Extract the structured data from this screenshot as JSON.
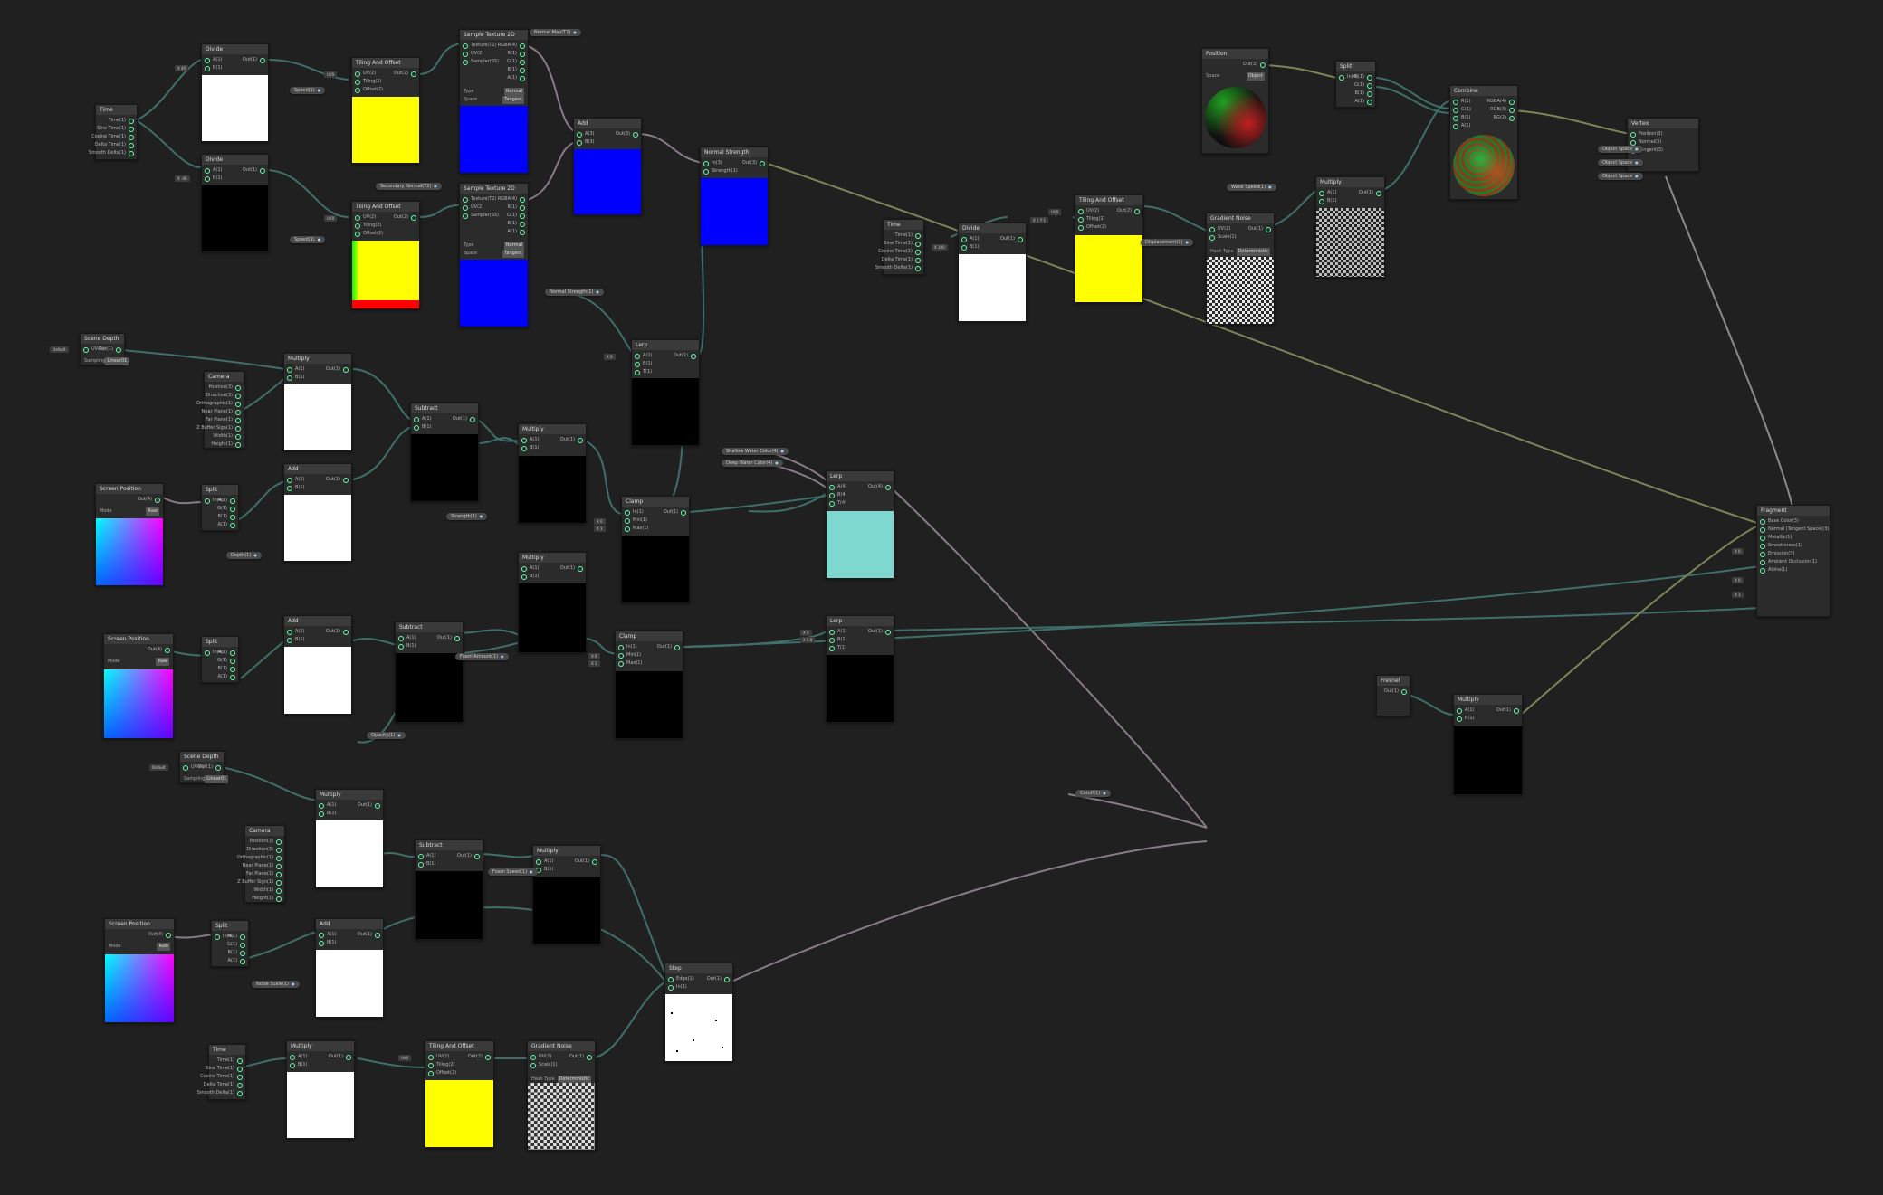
{
  "nodes": {
    "time_a": {
      "title": "Time",
      "ports_out": [
        "Time(1)",
        "Sine Time(1)",
        "Cosine Time(1)",
        "Delta Time(1)",
        "Smooth Delta(1)"
      ]
    },
    "divide_a": {
      "title": "Divide",
      "ports_in": [
        "A(1)",
        "B(1)"
      ],
      "ports_out": [
        "Out(1)"
      ]
    },
    "divide_b": {
      "title": "Divide",
      "ports_in": [
        "A(1)",
        "B(1)"
      ],
      "ports_out": [
        "Out(1)"
      ]
    },
    "tiling_a": {
      "title": "Tiling And Offset",
      "ports_in": [
        "UV(2)",
        "Tiling(2)",
        "Offset(2)"
      ],
      "ports_out": [
        "Out(2)"
      ]
    },
    "tiling_b": {
      "title": "Tiling And Offset",
      "ports_in": [
        "UV(2)",
        "Tiling(2)",
        "Offset(2)"
      ],
      "ports_out": [
        "Out(2)"
      ]
    },
    "sample_a": {
      "title": "Sample Texture 2D",
      "ports_in": [
        "Texture(T2)",
        "UV(2)",
        "Sampler(SS)"
      ],
      "ports_out": [
        "RGBA(4)",
        "R(1)",
        "G(1)",
        "B(1)",
        "A(1)"
      ],
      "type_label": "Type",
      "type_value": "Normal",
      "space_label": "Space",
      "space_value": "Tangent"
    },
    "sample_b": {
      "title": "Sample Texture 2D",
      "ports_in": [
        "Texture(T2)",
        "UV(2)",
        "Sampler(SS)"
      ],
      "ports_out": [
        "RGBA(4)",
        "R(1)",
        "G(1)",
        "B(1)",
        "A(1)"
      ],
      "type_label": "Type",
      "type_value": "Normal",
      "space_label": "Space",
      "space_value": "Tangent"
    },
    "add_normals": {
      "title": "Add",
      "ports_in": [
        "A(3)",
        "B(3)"
      ],
      "ports_out": [
        "Out(3)"
      ]
    },
    "normal_strength": {
      "title": "Normal Strength",
      "ports_in": [
        "In(3)",
        "Strength(1)"
      ],
      "ports_out": [
        "Out(3)"
      ]
    },
    "screen_depth": {
      "title": "Scene Depth",
      "ports_in": [
        "UV(4)"
      ],
      "ports_out": [
        "Out(1)"
      ],
      "sampling_label": "Sampling",
      "sampling_value": "Linear01"
    },
    "camera": {
      "title": "Camera",
      "ports_out": [
        "Position(3)",
        "Direction(3)",
        "Orthographic(1)",
        "Near Plane(1)",
        "Far Plane(1)",
        "Z Buffer Sign(1)",
        "Width(1)",
        "Height(1)"
      ]
    },
    "multiply_a": {
      "title": "Multiply",
      "ports_in": [
        "A(1)",
        "B(1)"
      ],
      "ports_out": [
        "Out(1)"
      ]
    },
    "screen_pos_a": {
      "title": "Screen Position",
      "ports_out": [
        "Out(4)"
      ],
      "mode_label": "Mode",
      "mode_value": "Raw"
    },
    "split_a": {
      "title": "Split",
      "ports_in": [
        "In(4)"
      ],
      "ports_out": [
        "R(1)",
        "G(1)",
        "B(1)",
        "A(1)"
      ]
    },
    "add_a": {
      "title": "Add",
      "ports_in": [
        "A(1)",
        "B(1)"
      ],
      "ports_out": [
        "Out(1)"
      ]
    },
    "subtract_a": {
      "title": "Subtract",
      "ports_in": [
        "A(1)",
        "B(1)"
      ],
      "ports_out": [
        "Out(1)"
      ]
    },
    "multiply_b": {
      "title": "Multiply",
      "ports_in": [
        "A(1)",
        "B(1)"
      ],
      "ports_out": [
        "Out(1)"
      ]
    },
    "lerp_mid": {
      "title": "Lerp",
      "ports_in": [
        "A(1)",
        "B(1)",
        "T(1)"
      ],
      "ports_out": [
        "Out(1)"
      ]
    },
    "clamp_a": {
      "title": "Clamp",
      "ports_in": [
        "In(1)",
        "Min(1)",
        "Max(1)"
      ],
      "ports_out": [
        "Out(1)"
      ]
    },
    "lerp_color": {
      "title": "Lerp",
      "ports_in": [
        "A(4)",
        "B(4)",
        "T(4)"
      ],
      "ports_out": [
        "Out(4)"
      ]
    },
    "screen_pos_b": {
      "title": "Screen Position",
      "ports_out": [
        "Out(4)"
      ],
      "mode_label": "Mode",
      "mode_value": "Raw"
    },
    "split_b": {
      "title": "Split",
      "ports_in": [
        "In(4)"
      ],
      "ports_out": [
        "R(1)",
        "G(1)",
        "B(1)",
        "A(1)"
      ]
    },
    "add_b": {
      "title": "Add",
      "ports_in": [
        "A(1)",
        "B(1)"
      ],
      "ports_out": [
        "Out(1)"
      ]
    },
    "subtract_b": {
      "title": "Subtract",
      "ports_in": [
        "A(1)",
        "B(1)"
      ],
      "ports_out": [
        "Out(1)"
      ]
    },
    "multiply_c": {
      "title": "Multiply",
      "ports_in": [
        "A(1)",
        "B(1)"
      ],
      "ports_out": [
        "Out(1)"
      ]
    },
    "clamp_b": {
      "title": "Clamp",
      "ports_in": [
        "In(1)",
        "Min(1)",
        "Max(1)"
      ],
      "ports_out": [
        "Out(1)"
      ]
    },
    "lerp_b": {
      "title": "Lerp",
      "ports_in": [
        "A(1)",
        "B(1)",
        "T(1)"
      ],
      "ports_out": [
        "Out(1)"
      ]
    },
    "screen_depth_b": {
      "title": "Scene Depth",
      "ports_in": [
        "UV(4)"
      ],
      "ports_out": [
        "Out(1)"
      ],
      "sampling_label": "Sampling",
      "sampling_value": "Linear01"
    },
    "camera_b": {
      "title": "Camera",
      "ports_out": [
        "Position(3)",
        "Direction(3)",
        "Orthographic(1)",
        "Near Plane(1)",
        "Far Plane(1)",
        "Z Buffer Sign(1)",
        "Width(1)",
        "Height(1)"
      ]
    },
    "multiply_d": {
      "title": "Multiply",
      "ports_in": [
        "A(1)",
        "B(1)"
      ],
      "ports_out": [
        "Out(1)"
      ]
    },
    "screen_pos_c": {
      "title": "Screen Position",
      "ports_out": [
        "Out(4)"
      ],
      "mode_label": "Mode",
      "mode_value": "Raw"
    },
    "split_c": {
      "title": "Split",
      "ports_in": [
        "In(4)"
      ],
      "ports_out": [
        "R(1)",
        "G(1)",
        "B(1)",
        "A(1)"
      ]
    },
    "add_c": {
      "title": "Add",
      "ports_in": [
        "A(1)",
        "B(1)"
      ],
      "ports_out": [
        "Out(1)"
      ]
    },
    "subtract_c": {
      "title": "Subtract",
      "ports_in": [
        "A(1)",
        "B(1)"
      ],
      "ports_out": [
        "Out(1)"
      ]
    },
    "multiply_e": {
      "title": "Multiply",
      "ports_in": [
        "A(1)",
        "B(1)"
      ],
      "ports_out": [
        "Out(1)"
      ]
    },
    "step": {
      "title": "Step",
      "ports_in": [
        "Edge(1)",
        "In(1)"
      ],
      "ports_out": [
        "Out(1)"
      ]
    },
    "time_b": {
      "title": "Time",
      "ports_out": [
        "Time(1)",
        "Sine Time(1)",
        "Cosine Time(1)",
        "Delta Time(1)",
        "Smooth Delta(1)"
      ]
    },
    "multiply_f": {
      "title": "Multiply",
      "ports_in": [
        "A(1)",
        "B(1)"
      ],
      "ports_out": [
        "Out(1)"
      ]
    },
    "tiling_c": {
      "title": "Tiling And Offset",
      "ports_in": [
        "UV(2)",
        "Tiling(2)",
        "Offset(2)"
      ],
      "ports_out": [
        "Out(2)"
      ]
    },
    "gradient_noise_b": {
      "title": "Gradient Noise",
      "ports_in": [
        "UV(2)",
        "Scale(1)"
      ],
      "ports_out": [
        "Out(1)"
      ],
      "hash_label": "Hash Type",
      "hash_value": "Deterministic"
    },
    "time_c": {
      "title": "Time",
      "ports_out": [
        "Time(1)",
        "Sine Time(1)",
        "Cosine Time(1)",
        "Delta Time(1)",
        "Smooth Delta(1)"
      ]
    },
    "divide_c": {
      "title": "Divide",
      "ports_in": [
        "A(1)",
        "B(1)"
      ],
      "ports_out": [
        "Out(1)"
      ]
    },
    "tiling_d": {
      "title": "Tiling And Offset",
      "ports_in": [
        "UV(2)",
        "Tiling(2)",
        "Offset(2)"
      ],
      "ports_out": [
        "Out(2)"
      ]
    },
    "gradient_noise_a": {
      "title": "Gradient Noise",
      "ports_in": [
        "UV(2)",
        "Scale(1)"
      ],
      "ports_out": [
        "Out(1)"
      ],
      "hash_label": "Hash Type",
      "hash_value": "Deterministic"
    },
    "multiply_g": {
      "title": "Multiply",
      "ports_in": [
        "A(1)",
        "B(1)"
      ],
      "ports_out": [
        "Out(1)"
      ]
    },
    "position": {
      "title": "Position",
      "ports_out": [
        "Out(3)"
      ],
      "space_label": "Space",
      "space_value": "Object"
    },
    "split_d": {
      "title": "Split",
      "ports_in": [
        "In(4)"
      ],
      "ports_out": [
        "R(1)",
        "G(1)",
        "B(1)",
        "A(1)"
      ]
    },
    "combine": {
      "title": "Combine",
      "ports_in": [
        "R(1)",
        "G(1)",
        "B(1)",
        "A(1)"
      ],
      "ports_out": [
        "RGBA(4)",
        "RGB(3)",
        "RG(2)"
      ]
    },
    "vertex": {
      "title": "Vertex",
      "ports_in": [
        "Position(3)",
        "Normal(3)",
        "Tangent(3)"
      ]
    },
    "fragment": {
      "title": "Fragment",
      "ports_in": [
        "Base Color(3)",
        "Normal (Tangent Space)(3)",
        "Metallic(1)",
        "Smoothness(1)",
        "Emission(3)",
        "Ambient Occlusion(1)",
        "Alpha(1)"
      ]
    },
    "fresnel": {
      "title": "Fresnel",
      "ports_out": [
        "Out(1)"
      ]
    },
    "multiply_h": {
      "title": "Multiply",
      "ports_in": [
        "A(1)",
        "B(1)"
      ],
      "ports_out": [
        "Out(1)"
      ]
    }
  },
  "pills": {
    "normal_map_a": "Normal Map(T2)",
    "normal_map_b": "Secondary Normal(T2)",
    "speed_a": "Speed(1)",
    "speed_b": "Speed(1)",
    "normal_strength": "Normal Strength(1)",
    "strength": "Strength(1)",
    "depth": "Depth(1)",
    "shallow_water": "Shallow Water Color(4)",
    "deep_water": "Deep Water Color(4)",
    "foam_amount": "Foam Amount(1)",
    "opacity": "Opacity(1)",
    "foam_speed": "Foam Speed(1)",
    "noise_scale": "Noise Scale(1)",
    "displacement": "Displacement(1)",
    "wave_speed": "Wave Speed(1)",
    "cutoff": "Cutoff(1)",
    "object_space_a": "Object Space",
    "object_space_b": "Object Space",
    "object_space_c": "Object Space"
  },
  "colors": {
    "background": "#202020",
    "node_body": "#2b2b2b",
    "node_header": "#3a3a3a",
    "wire_teal": "#3f6f6a",
    "wire_olive": "#7d8456",
    "wire_mauve": "#8a7a8a",
    "preview_yellow": "#ffff00",
    "preview_blue": "#0000ff",
    "preview_cyan": "#7fd8d0",
    "port_ring": "#66ffaa"
  }
}
